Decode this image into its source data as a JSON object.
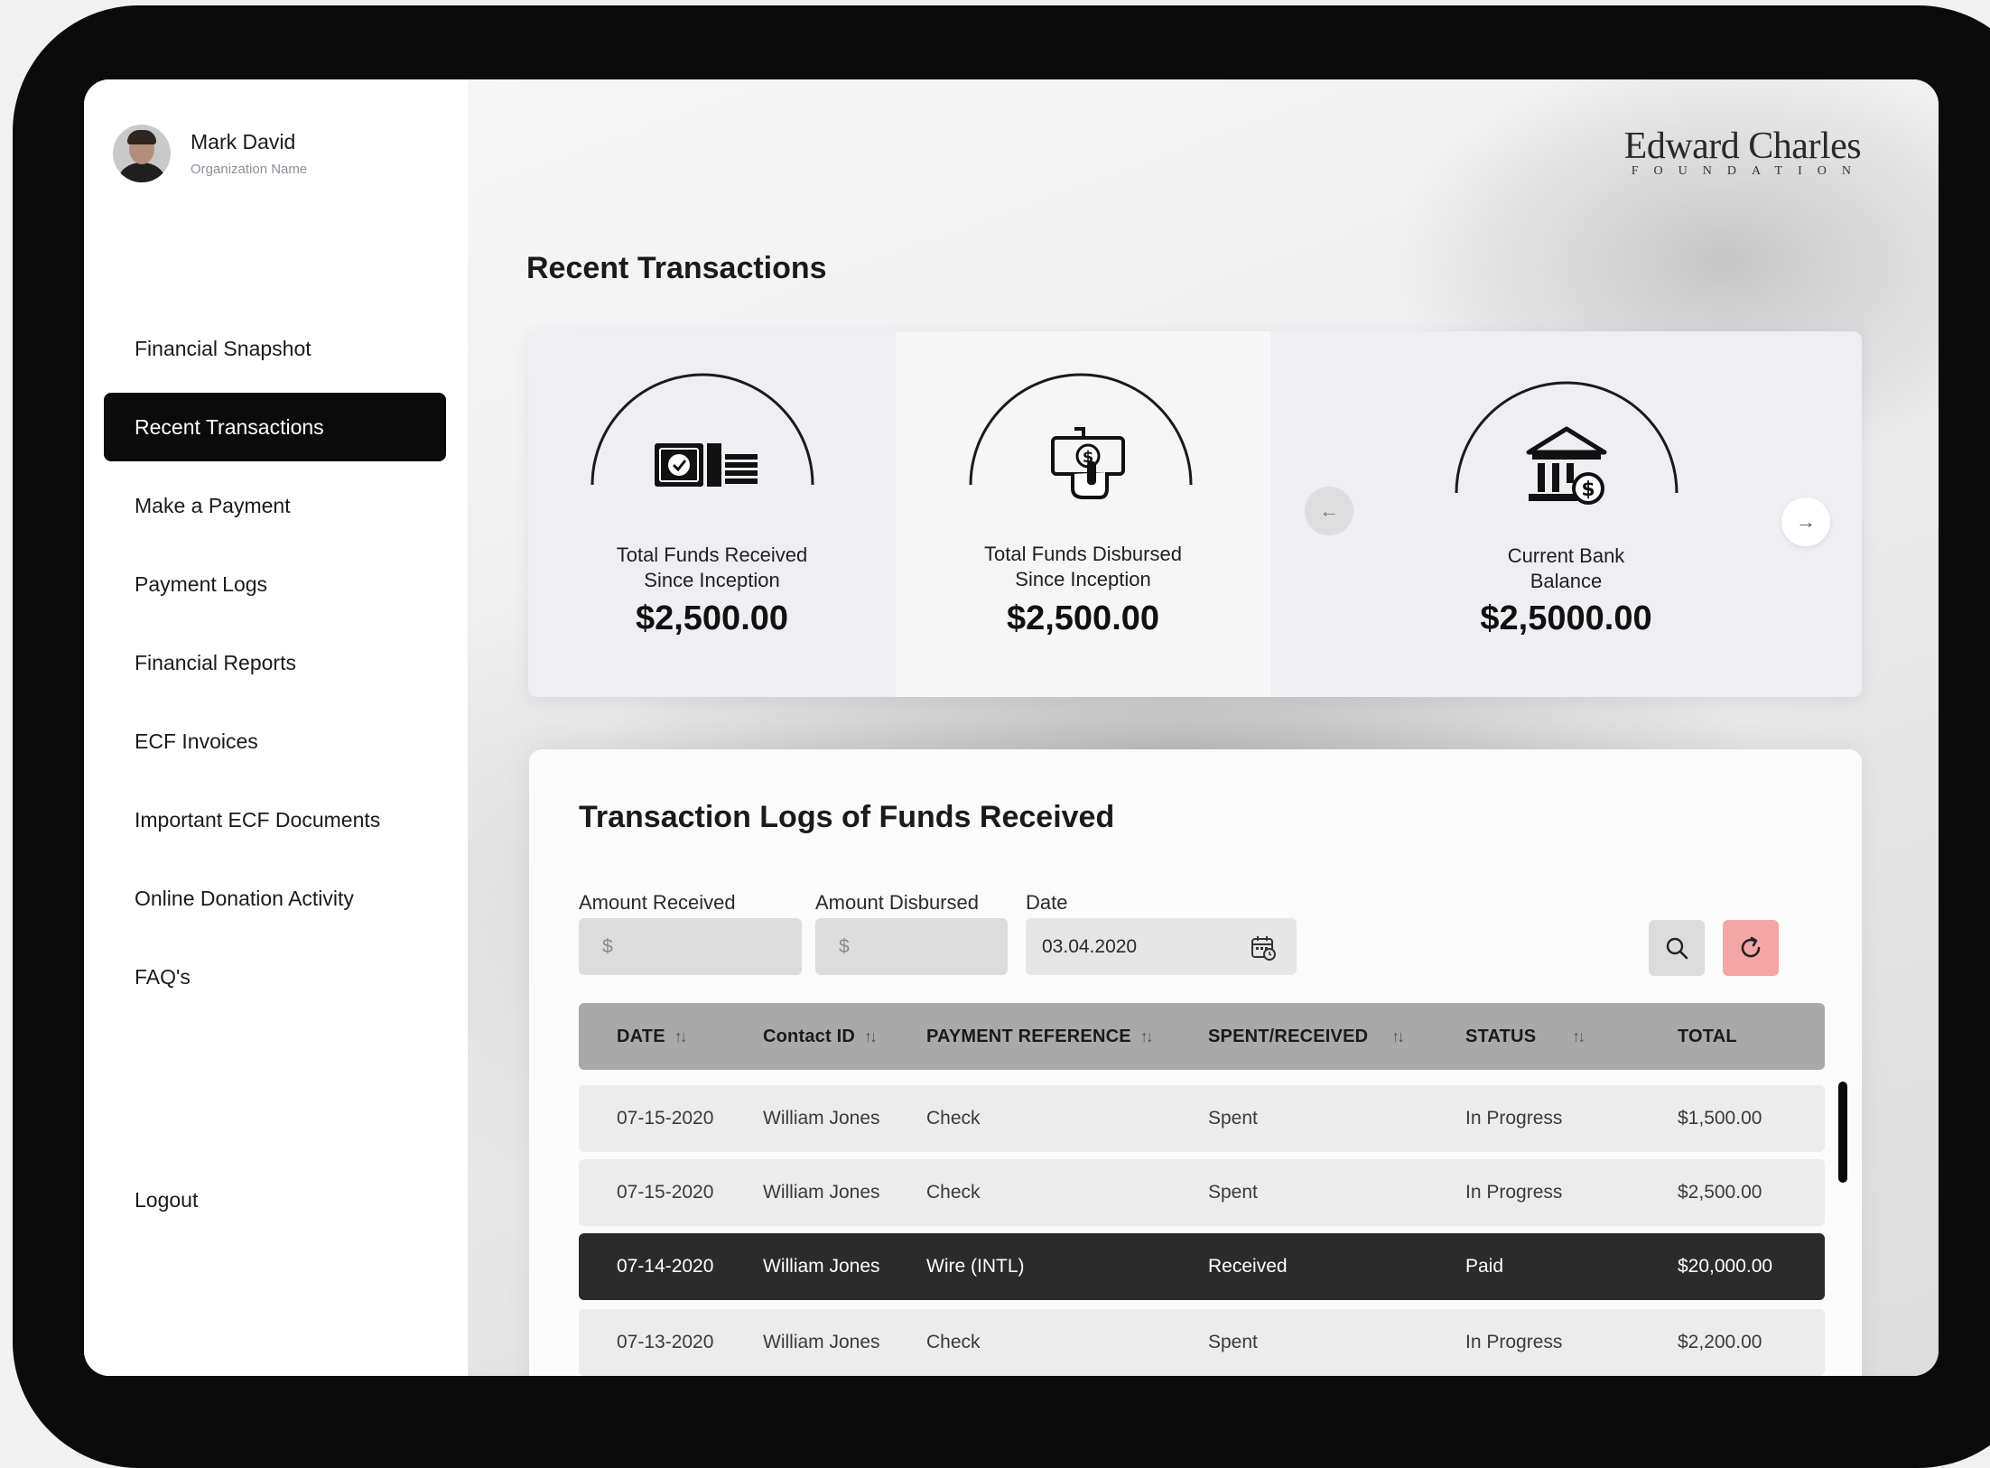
{
  "user": {
    "name": "Mark David",
    "org": "Organization Name"
  },
  "nav": {
    "items": [
      {
        "label": "Financial Snapshot"
      },
      {
        "label": "Recent Transactions"
      },
      {
        "label": "Make a Payment"
      },
      {
        "label": "Payment Logs"
      },
      {
        "label": "Financial Reports"
      },
      {
        "label": "ECF Invoices"
      },
      {
        "label": "Important ECF Documents"
      },
      {
        "label": "Online Donation Activity"
      },
      {
        "label": "FAQ's"
      }
    ],
    "active_index": 1,
    "logout": "Logout"
  },
  "brand": {
    "top": "Edward Charles",
    "sub": "FOUNDATION"
  },
  "page": {
    "title": "Recent Transactions"
  },
  "cards": [
    {
      "label_line1": "Total Funds Received",
      "label_line2": "Since Inception",
      "value": "$2,500.00",
      "icon": "cash-stack-icon"
    },
    {
      "label_line1": "Total Funds Disbursed",
      "label_line2": "Since Inception",
      "value": "$2,500.00",
      "icon": "hand-money-icon"
    },
    {
      "label_line1": "Current Bank",
      "label_line2": "Balance",
      "value": "$2,5000.00",
      "icon": "bank-dollar-icon"
    }
  ],
  "carousel": {
    "prev": "←",
    "next": "→"
  },
  "logs": {
    "title": "Transaction Logs of Funds Received",
    "filters": {
      "amount_received": {
        "label": "Amount Received",
        "placeholder": "$"
      },
      "amount_disbursed": {
        "label": "Amount Disbursed",
        "placeholder": "$"
      },
      "date": {
        "label": "Date",
        "value": "03.04.2020"
      }
    },
    "columns": [
      {
        "label": "DATE",
        "sortable": true
      },
      {
        "label": "Contact ID",
        "sortable": true
      },
      {
        "label": "PAYMENT REFERENCE",
        "sortable": true
      },
      {
        "label": "SPENT/RECEIVED",
        "sortable": true
      },
      {
        "label": "STATUS",
        "sortable": true
      },
      {
        "label": "TOTAL",
        "sortable": false
      }
    ],
    "sort_glyph": "↑↓",
    "rows": [
      {
        "date": "07-15-2020",
        "contact": "William Jones",
        "reference": "Check",
        "type": "Spent",
        "status": "In Progress",
        "total": "$1,500.00"
      },
      {
        "date": "07-15-2020",
        "contact": "William Jones",
        "reference": "Check",
        "type": "Spent",
        "status": "In Progress",
        "total": "$2,500.00"
      },
      {
        "date": "07-14-2020",
        "contact": "William Jones",
        "reference": "Wire (INTL)",
        "type": "Received",
        "status": "Paid",
        "total": "$20,000.00"
      },
      {
        "date": "07-13-2020",
        "contact": "William Jones",
        "reference": "Check",
        "type": "Spent",
        "status": "In Progress",
        "total": "$2,200.00"
      }
    ],
    "highlighted_row": 2
  },
  "colors": {
    "sidebar_active": "#0b0b0b",
    "refresh_button": "#f4a6a6",
    "table_header": "#a9a9a9",
    "row_highlight": "#2b2b2b"
  }
}
